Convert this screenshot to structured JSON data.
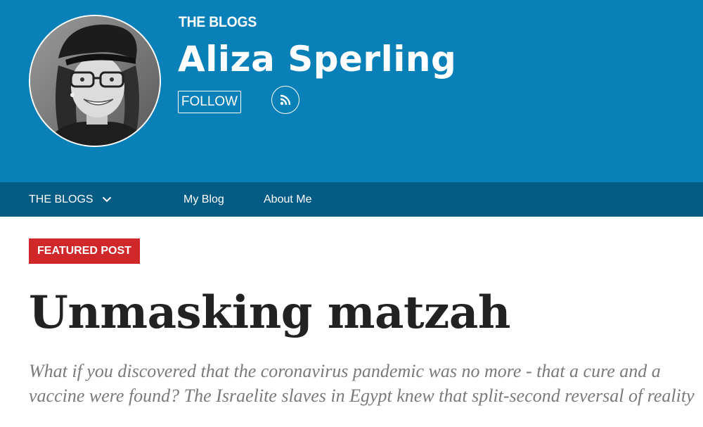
{
  "header": {
    "kicker": "THE BLOGS",
    "author_name": "Aliza Sperling",
    "follow_label": "FOLLOW",
    "rss_icon": "rss-icon",
    "avatar": "author-photo"
  },
  "nav": {
    "blogs_label": "THE BLOGS",
    "blogs_icon": "chevron-down-icon",
    "items": [
      {
        "label": "My Blog"
      },
      {
        "label": "About Me"
      }
    ]
  },
  "post": {
    "badge": "FEATURED POST",
    "title": "Unmasking matzah",
    "excerpt": "What if you discovered that the coronavirus pandemic was no more - that a cure and a vaccine were found? The Israelite slaves in Egypt knew that split-second reversal of reality"
  },
  "colors": {
    "header_bg": "#0a80b8",
    "nav_bg": "#045b84",
    "badge_bg": "#d0282a",
    "title_text": "#222222",
    "excerpt_text": "#7a7a7a"
  }
}
